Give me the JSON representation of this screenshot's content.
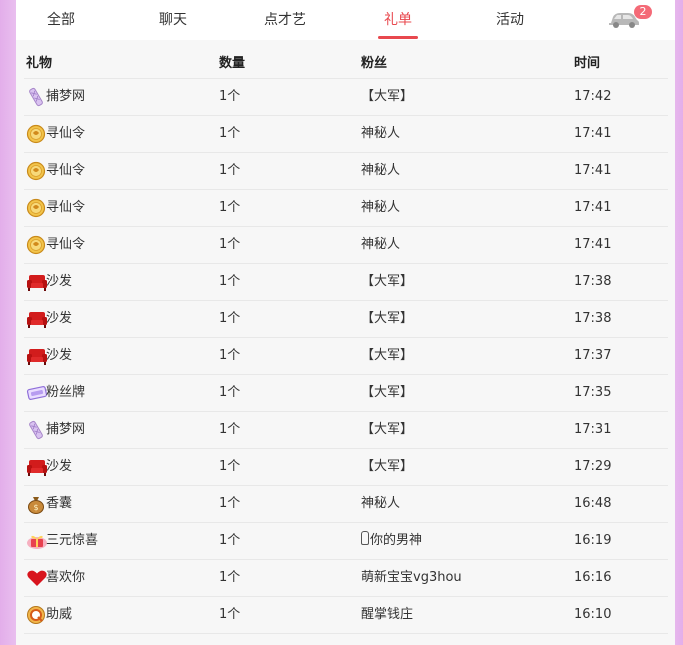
{
  "tabs": [
    {
      "label": "全部",
      "active": false
    },
    {
      "label": "聊天",
      "active": false
    },
    {
      "label": "点才艺",
      "active": false
    },
    {
      "label": "礼单",
      "active": true
    },
    {
      "label": "活动",
      "active": false
    }
  ],
  "car": {
    "icon": "car-icon",
    "badge": "2"
  },
  "accent_color": "#e8484e",
  "table": {
    "headers": {
      "gift": "礼物",
      "qty": "数量",
      "fan": "粉丝",
      "time": "时间"
    },
    "rows": [
      {
        "icon": "dreamcatcher-icon",
        "gift": "捕梦网",
        "qty": "1个",
        "fan": "【大军】",
        "time": "17:42"
      },
      {
        "icon": "xunxian-token-icon",
        "gift": "寻仙令",
        "qty": "1个",
        "fan": "神秘人",
        "time": "17:41"
      },
      {
        "icon": "xunxian-token-icon",
        "gift": "寻仙令",
        "qty": "1个",
        "fan": "神秘人",
        "time": "17:41"
      },
      {
        "icon": "xunxian-token-icon",
        "gift": "寻仙令",
        "qty": "1个",
        "fan": "神秘人",
        "time": "17:41"
      },
      {
        "icon": "xunxian-token-icon",
        "gift": "寻仙令",
        "qty": "1个",
        "fan": "神秘人",
        "time": "17:41"
      },
      {
        "icon": "sofa-icon",
        "gift": "沙发",
        "qty": "1个",
        "fan": "【大军】",
        "time": "17:38"
      },
      {
        "icon": "sofa-icon",
        "gift": "沙发",
        "qty": "1个",
        "fan": "【大军】",
        "time": "17:38"
      },
      {
        "icon": "sofa-icon",
        "gift": "沙发",
        "qty": "1个",
        "fan": "【大军】",
        "time": "17:37"
      },
      {
        "icon": "fan-badge-icon",
        "gift": "粉丝牌",
        "qty": "1个",
        "fan": "【大军】",
        "time": "17:35"
      },
      {
        "icon": "dreamcatcher-icon",
        "gift": "捕梦网",
        "qty": "1个",
        "fan": "【大军】",
        "time": "17:31"
      },
      {
        "icon": "sofa-icon",
        "gift": "沙发",
        "qty": "1个",
        "fan": "【大军】",
        "time": "17:29"
      },
      {
        "icon": "money-bag-icon",
        "gift": "香囊",
        "qty": "1个",
        "fan": "神秘人",
        "time": "16:48"
      },
      {
        "icon": "surprise-box-icon",
        "gift": "三元惊喜",
        "qty": "1个",
        "fan": "你的男神",
        "fan_mark": "bottle-icon",
        "time": "16:19"
      },
      {
        "icon": "love-heart-icon",
        "gift": "喜欢你",
        "qty": "1个",
        "fan": "萌新宝宝vg3hou",
        "time": "16:16"
      },
      {
        "icon": "zhuwei-icon",
        "gift": "助威",
        "qty": "1个",
        "fan": "醒掌钱庄",
        "time": "16:10"
      }
    ]
  }
}
